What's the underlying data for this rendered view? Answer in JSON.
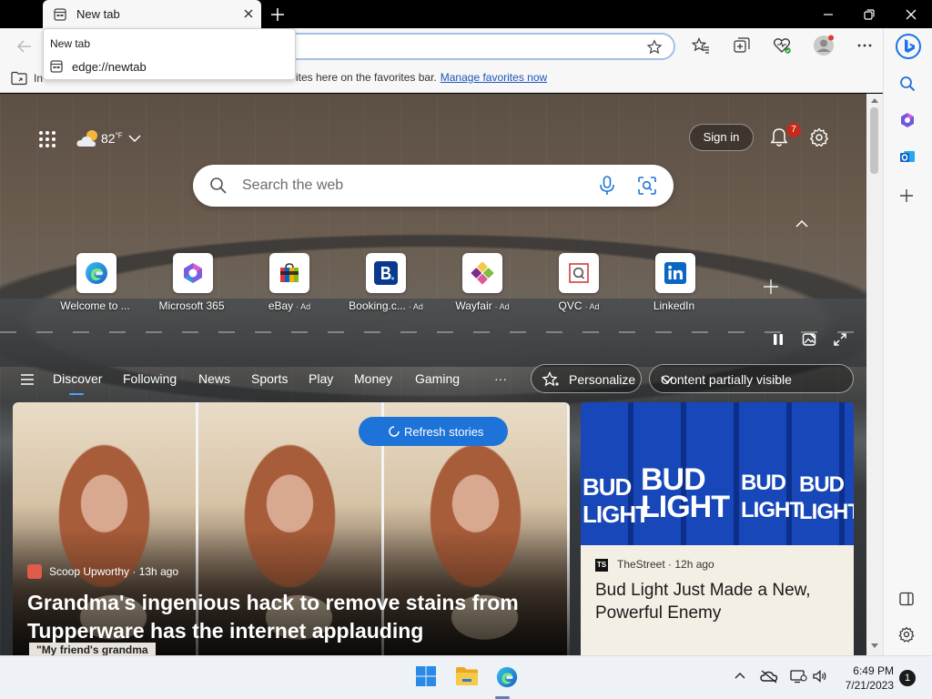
{
  "tab": {
    "title": "New tab"
  },
  "tooltip": {
    "title": "New tab",
    "url": "edge://newtab"
  },
  "favorites": {
    "lead": "In",
    "text": "ites here on the favorites bar.",
    "link": "Manage favorites now"
  },
  "weather": {
    "temp": "82",
    "unit": "°F"
  },
  "header": {
    "sign_in": "Sign in",
    "notification_count": "7"
  },
  "search": {
    "placeholder": "Search the web"
  },
  "quick_links": [
    {
      "label": "Welcome to ...",
      "ad": ""
    },
    {
      "label": "Microsoft 365",
      "ad": ""
    },
    {
      "label": "eBay",
      "ad": "· Ad"
    },
    {
      "label": "Booking.c...",
      "ad": "· Ad"
    },
    {
      "label": "Wayfair",
      "ad": "· Ad"
    },
    {
      "label": "QVC",
      "ad": "· Ad"
    },
    {
      "label": "LinkedIn",
      "ad": ""
    }
  ],
  "nav": {
    "items": [
      "Discover",
      "Following",
      "News",
      "Sports",
      "Play",
      "Money",
      "Gaming"
    ],
    "more": "···",
    "personalize": "Personalize",
    "visibility": "Content partially visible"
  },
  "main_card": {
    "refresh": "Refresh stories",
    "source": "Scoop Upworthy · 13h ago",
    "title": "Grandma's ingenious hack to remove stains from Tupperware has the internet applauding",
    "snippet": "\"My friend's grandma"
  },
  "side_card": {
    "source_logo": "TS",
    "source": "TheStreet · 12h ago",
    "title": "Bud Light Just Made a New, Powerful Enemy",
    "can_text": "BUD LIGHT"
  },
  "taskbar": {
    "time": "6:49 PM",
    "date": "7/21/2023",
    "notifications": "1"
  },
  "colors": {
    "accent": "#1e73d8",
    "badge": "#c42b1c",
    "bing": "#1a73e8"
  }
}
